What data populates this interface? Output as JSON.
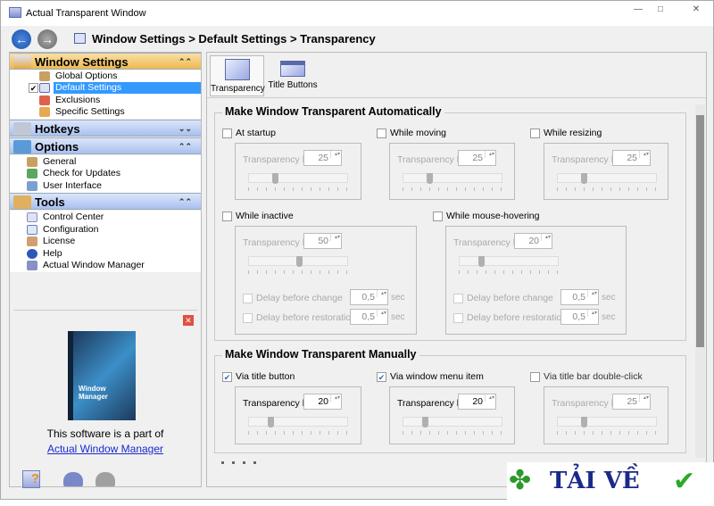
{
  "window": {
    "title": "Actual Transparent Window",
    "min": "—",
    "max": "□",
    "close": "✕"
  },
  "nav": {
    "back": "←",
    "forward": "→",
    "breadcrumb": "Window Settings > Default Settings > Transparency"
  },
  "sidebar": {
    "sections": [
      {
        "label": "Window Settings",
        "state": "expanded",
        "chevron": "⌃⌃",
        "items": [
          "Global Options",
          "Default Settings",
          "Exclusions",
          "Specific Settings"
        ],
        "selected": "Default Settings"
      },
      {
        "label": "Hotkeys",
        "state": "collapsed",
        "chevron": "⌄⌄",
        "items": []
      },
      {
        "label": "Options",
        "state": "expanded",
        "chevron": "⌃⌃",
        "items": [
          "General",
          "Check for Updates",
          "User Interface"
        ]
      },
      {
        "label": "Tools",
        "state": "expanded",
        "chevron": "⌃⌃",
        "items": [
          "Control Center",
          "Configuration",
          "License",
          "Help",
          "Actual Window Manager"
        ]
      }
    ],
    "promo": {
      "close": "✕",
      "box_label": "Window Manager",
      "text": "This software is a part of",
      "link": "Actual Window Manager"
    },
    "bottom_icons": [
      "help-icon",
      "undo-icon",
      "redo-icon"
    ]
  },
  "tabs": [
    {
      "label": "Transparency",
      "active": true
    },
    {
      "label": "Title Buttons",
      "active": false
    }
  ],
  "auto": {
    "title": "Make Window Transparent Automatically",
    "level_label": "Transparency level",
    "sec": "sec",
    "delay_change": "Delay before change",
    "delay_restore": "Delay before restoration",
    "options": [
      {
        "label": "At startup",
        "checked": false,
        "level": "25"
      },
      {
        "label": "While moving",
        "checked": false,
        "level": "25"
      },
      {
        "label": "While resizing",
        "checked": false,
        "level": "25"
      },
      {
        "label": "While inactive",
        "checked": false,
        "level": "50",
        "delay_change": "0,5",
        "delay_restore": "0,5"
      },
      {
        "label": "While mouse-hovering",
        "checked": false,
        "level": "20",
        "delay_change": "0,5",
        "delay_restore": "0,5"
      }
    ]
  },
  "manual": {
    "title": "Make Window Transparent Manually",
    "level_label": "Transparency level",
    "options": [
      {
        "label": "Via title button",
        "checked": true,
        "level": "20"
      },
      {
        "label": "Via window menu item",
        "checked": true,
        "level": "20"
      },
      {
        "label": "Via title bar double-click",
        "checked": false,
        "level": "25"
      }
    ]
  },
  "watermark": {
    "text": "TẢI VỀ",
    "check": "✔"
  }
}
